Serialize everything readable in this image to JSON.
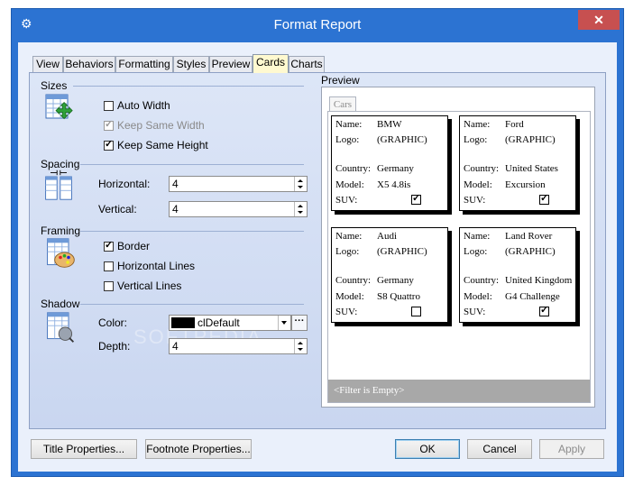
{
  "window": {
    "title": "Format Report",
    "close_glyph": "✕",
    "app_icon": "gear-icon"
  },
  "tabs": [
    {
      "label": "View",
      "active": false
    },
    {
      "label": "Behaviors",
      "active": false
    },
    {
      "label": "Formatting",
      "active": false
    },
    {
      "label": "Styles",
      "active": false
    },
    {
      "label": "Preview",
      "active": false
    },
    {
      "label": "Cards",
      "active": true
    },
    {
      "label": "Charts",
      "active": false
    }
  ],
  "sizes": {
    "label": "Sizes",
    "auto_width": {
      "label": "Auto Width",
      "checked": false,
      "enabled": true
    },
    "keep_same_width": {
      "label": "Keep Same Width",
      "checked": true,
      "enabled": false
    },
    "keep_same_height": {
      "label": "Keep Same Height",
      "checked": true,
      "enabled": true
    }
  },
  "spacing": {
    "label": "Spacing",
    "horizontal_label": "Horizontal:",
    "horizontal_value": "4",
    "vertical_label": "Vertical:",
    "vertical_value": "4"
  },
  "framing": {
    "label": "Framing",
    "border": {
      "label": "Border",
      "checked": true
    },
    "horizontal_lines": {
      "label": "Horizontal Lines",
      "checked": false
    },
    "vertical_lines": {
      "label": "Vertical Lines",
      "checked": false
    }
  },
  "shadow": {
    "label": "Shadow",
    "color_label": "Color:",
    "color_value": "clDefault",
    "color_swatch": "#000000",
    "ellipsis": "···",
    "depth_label": "Depth:",
    "depth_value": "4"
  },
  "preview": {
    "label": "Preview",
    "tab_label": "Cars",
    "filter_text": "<Filter is Empty>",
    "field_labels": {
      "name": "Name:",
      "logo": "Logo:",
      "country": "Country:",
      "model": "Model:",
      "suv": "SUV:"
    },
    "cards": [
      {
        "name": "BMW",
        "logo": "(GRAPHIC)",
        "country": "Germany",
        "model": "X5 4.8is",
        "suv": true
      },
      {
        "name": "Ford",
        "logo": "(GRAPHIC)",
        "country": "United States",
        "model": "Excursion",
        "suv": true
      },
      {
        "name": "Audi",
        "logo": "(GRAPHIC)",
        "country": "Germany",
        "model": "S8 Quattro",
        "suv": false
      },
      {
        "name": "Land Rover",
        "logo": "(GRAPHIC)",
        "country": "United Kingdom",
        "model": "G4 Challenge",
        "suv": true
      }
    ]
  },
  "buttons": {
    "title_properties": "Title Properties...",
    "footnote_properties": "Footnote Properties...",
    "ok": "OK",
    "cancel": "Cancel",
    "apply": "Apply"
  },
  "watermark": "SOFTPEDIA"
}
